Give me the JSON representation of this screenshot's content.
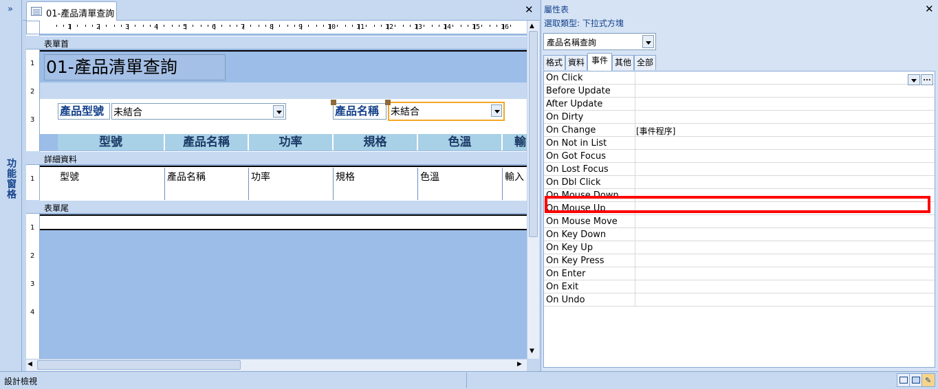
{
  "nav_pane": {
    "expand_glyph": "»",
    "label": "功能窗格"
  },
  "document_tab": {
    "title": "01-產品清單查詢",
    "close_glyph": "✕"
  },
  "ruler": {
    "marks": [
      "1",
      "2",
      "3",
      "4",
      "5",
      "6",
      "7",
      "8",
      "9",
      "10",
      "11",
      "12",
      "13",
      "14",
      "15",
      "16"
    ]
  },
  "vruler_marks": {
    "header": [
      "1",
      "2",
      "3"
    ],
    "detail": [
      "1"
    ],
    "footer": [
      "1",
      "2",
      "3",
      "4"
    ]
  },
  "sections": {
    "form_header": "表單首",
    "detail": "詳細資料",
    "form_footer": "表單尾"
  },
  "form": {
    "title": "01-產品清單查詢",
    "model_label": "產品型號",
    "model_combo": "未結合",
    "name_label": "產品名稱",
    "name_combo": "未結合",
    "column_headers": [
      "型號",
      "產品名稱",
      "功率",
      "規格",
      "色溫",
      "輸"
    ],
    "detail_fields": [
      "型號",
      "產品名稱",
      "功率",
      "規格",
      "色溫",
      "輸入"
    ]
  },
  "property_sheet": {
    "title": "屬性表",
    "selection_type": "選取類型:  下拉式方塊",
    "selected_object": "產品名稱查詢",
    "close_glyph": "✕",
    "tabs": [
      "格式",
      "資料",
      "事件",
      "其他",
      "全部"
    ],
    "active_tab": "事件",
    "rows": [
      {
        "name": "On Click",
        "value": ""
      },
      {
        "name": "Before Update",
        "value": ""
      },
      {
        "name": "After Update",
        "value": ""
      },
      {
        "name": "On Dirty",
        "value": ""
      },
      {
        "name": "On Change",
        "value": "[事件程序]"
      },
      {
        "name": "On Not in List",
        "value": ""
      },
      {
        "name": "On Got Focus",
        "value": ""
      },
      {
        "name": "On Lost Focus",
        "value": ""
      },
      {
        "name": "On Dbl Click",
        "value": ""
      },
      {
        "name": "On Mouse Down",
        "value": ""
      },
      {
        "name": "On Mouse Up",
        "value": ""
      },
      {
        "name": "On Mouse Move",
        "value": ""
      },
      {
        "name": "On Key Down",
        "value": ""
      },
      {
        "name": "On Key Up",
        "value": ""
      },
      {
        "name": "On Key Press",
        "value": ""
      },
      {
        "name": "On Enter",
        "value": ""
      },
      {
        "name": "On Exit",
        "value": ""
      },
      {
        "name": "On Undo",
        "value": ""
      }
    ],
    "highlighted_row": "On Change",
    "builder_glyph": "..."
  },
  "status_bar": {
    "text": "設計檢視"
  },
  "colors": {
    "accent": "#15428b",
    "highlight": "#ff0000",
    "selection_border": "#f5a623"
  }
}
